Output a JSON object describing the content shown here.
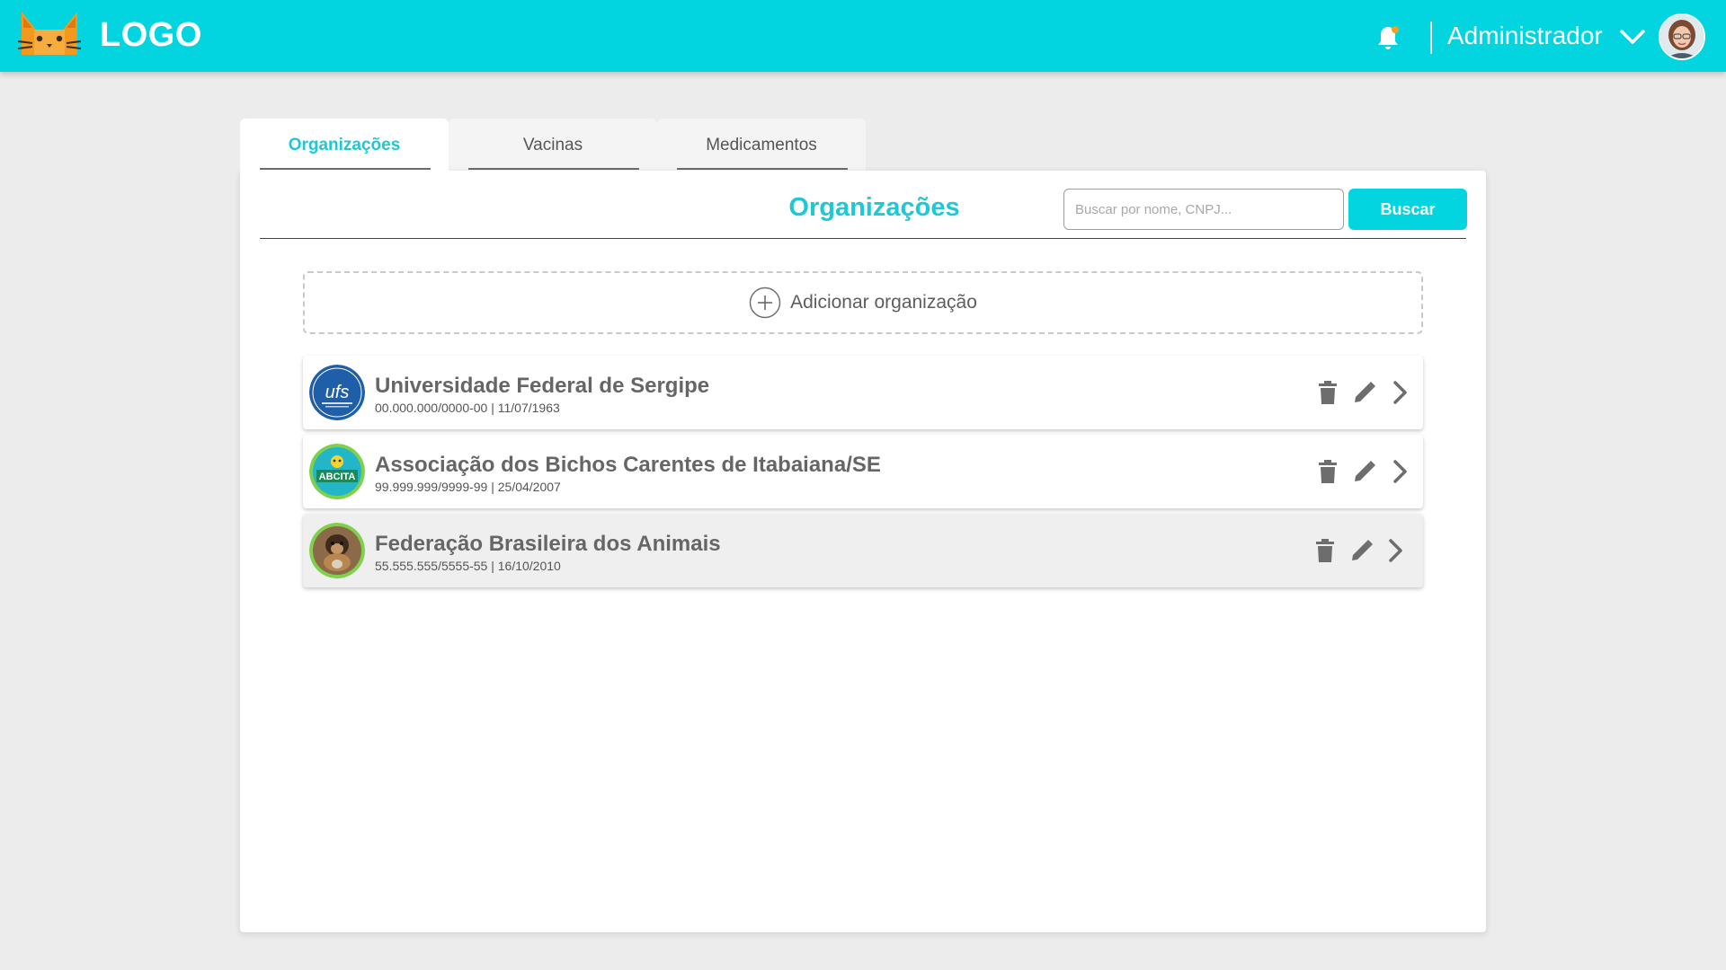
{
  "header": {
    "logo_text": "LOGO",
    "user_name": "Administrador",
    "brand_color": "#02d4e0",
    "icons": [
      "cat-logo-icon",
      "bell-icon",
      "chevron-down-icon",
      "avatar"
    ]
  },
  "tabs": [
    {
      "label": "Organizações",
      "active": true
    },
    {
      "label": "Vacinas",
      "active": false
    },
    {
      "label": "Medicamentos",
      "active": false
    }
  ],
  "main": {
    "title": "Organizações",
    "search_placeholder": "Buscar por nome, CNPJ...",
    "search_value": "",
    "search_button": "Buscar",
    "add_label": "Adicionar organização",
    "accent_color": "#1ec8d4"
  },
  "organizations": [
    {
      "name": "Universidade Federal de Sergipe",
      "meta": "00.000.000/0000-00 | 11/07/1963",
      "logo_text": "ufs"
    },
    {
      "name": "Associação dos Bichos Carentes de Itabaiana/SE",
      "meta": "99.999.999/9999-99 | 25/04/2007",
      "logo_text": "ABCITA"
    },
    {
      "name": "Federação Brasileira dos Animais",
      "meta": "55.555.555/5555-55 | 16/10/2010",
      "logo_text": ""
    }
  ],
  "row_actions": [
    "trash-icon",
    "pencil-icon",
    "chevron-right-icon"
  ]
}
